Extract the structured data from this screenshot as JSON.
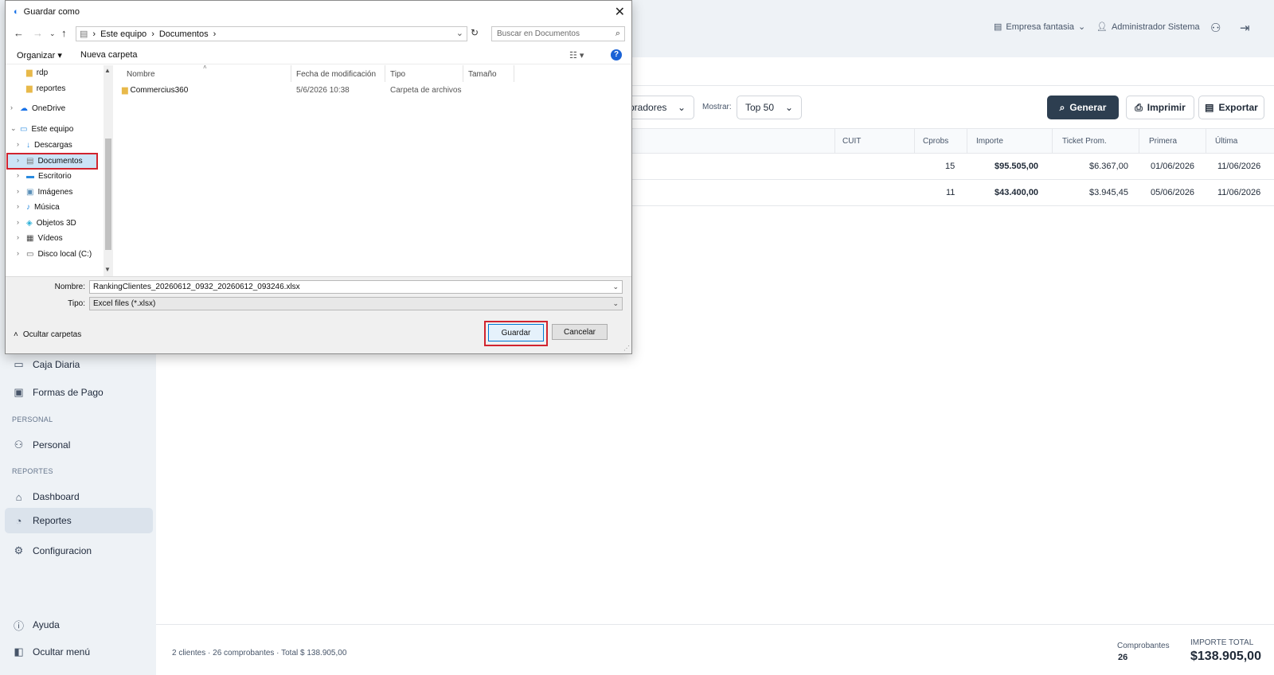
{
  "app": {
    "topbar": {
      "company": "Empresa fantasia",
      "user": "Administrador Sistema"
    },
    "sidebar": {
      "items_top": [
        {
          "label": "Caja Diaria",
          "icon": "cash-register-icon"
        },
        {
          "label": "Formas de Pago",
          "icon": "payment-icon"
        }
      ],
      "section_personal": "PERSONAL",
      "personal": {
        "label": "Personal",
        "icon": "people-icon"
      },
      "section_reportes": "REPORTES",
      "reportes_items": [
        {
          "label": "Dashboard",
          "icon": "home-icon"
        },
        {
          "label": "Reportes",
          "icon": "reports-icon",
          "active": true
        },
        {
          "label": "Configuracion",
          "icon": "gear-icon"
        }
      ],
      "ayuda": "Ayuda",
      "ocultar_menu": "Ocultar menú"
    },
    "filters": {
      "sort_value": "pradores",
      "mostrar_label": "Mostrar:",
      "mostrar_value": "Top 50"
    },
    "actions": {
      "generar": "Generar",
      "imprimir": "Imprimir",
      "exportar": "Exportar"
    },
    "table": {
      "headers": [
        "CUIT",
        "Cprobs",
        "Importe",
        "Ticket Prom.",
        "Primera",
        "Última"
      ],
      "rows": [
        {
          "cprobs": "15",
          "importe": "$95.505,00",
          "ticket": "$6.367,00",
          "primera": "01/06/2026",
          "ultima": "11/06/2026"
        },
        {
          "cprobs": "11",
          "importe": "$43.400,00",
          "ticket": "$3.945,45",
          "primera": "05/06/2026",
          "ultima": "11/06/2026"
        }
      ]
    },
    "footer": {
      "summary": "2 clientes · 26 comprobantes · Total $ 138.905,00",
      "comprobantes_label": "Comprobantes",
      "comprobantes_value": "26",
      "importe_label": "IMPORTE TOTAL",
      "importe_value": "$138.905,00"
    }
  },
  "dialog": {
    "title": "Guardar como",
    "address": {
      "root": "Este equipo",
      "folder": "Documentos"
    },
    "search_placeholder": "Buscar en Documentos",
    "toolbar": {
      "organizar": "Organizar",
      "nueva_carpeta": "Nueva carpeta"
    },
    "tree": [
      {
        "label": "rdp",
        "icon": "folder-icon"
      },
      {
        "label": "reportes",
        "icon": "folder-icon"
      },
      {
        "label": "OneDrive",
        "icon": "cloud-icon"
      },
      {
        "label": "Este equipo",
        "icon": "computer-icon"
      },
      {
        "label": "Descargas",
        "icon": "download-icon"
      },
      {
        "label": "Documentos",
        "icon": "document-icon",
        "selected": true
      },
      {
        "label": "Escritorio",
        "icon": "desktop-icon"
      },
      {
        "label": "Imágenes",
        "icon": "image-icon"
      },
      {
        "label": "Música",
        "icon": "music-icon"
      },
      {
        "label": "Objetos 3D",
        "icon": "cube-icon"
      },
      {
        "label": "Vídeos",
        "icon": "video-icon"
      },
      {
        "label": "Disco local (C:)",
        "icon": "drive-icon"
      }
    ],
    "columns": [
      "Nombre",
      "Fecha de modificación",
      "Tipo",
      "Tamaño"
    ],
    "files": [
      {
        "name": "Commercius360",
        "date": "5/6/2026 10:38",
        "type": "Carpeta de archivos"
      }
    ],
    "nombre_label": "Nombre:",
    "nombre_value": "RankingClientes_20260612_0932_20260612_093246.xlsx",
    "tipo_label": "Tipo:",
    "tipo_value": "Excel files (*.xlsx)",
    "ocultar_carpetas": "Ocultar carpetas",
    "guardar": "Guardar",
    "cancelar": "Cancelar"
  }
}
